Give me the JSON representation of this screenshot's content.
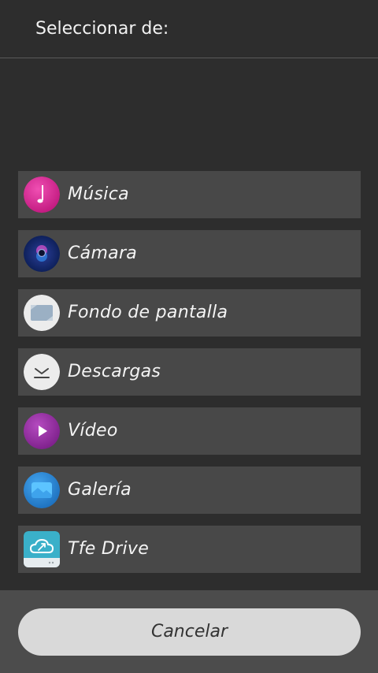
{
  "dialog": {
    "title": "Seleccionar de:"
  },
  "options": [
    {
      "label": "Música",
      "icon": "music-icon",
      "color": "#e02a9a"
    },
    {
      "label": "Cámara",
      "icon": "camera-icon",
      "color": "#0f2a6e"
    },
    {
      "label": "Fondo de pantalla",
      "icon": "wallpaper-icon",
      "color": "#e8e8e8"
    },
    {
      "label": "Descargas",
      "icon": "download-icon",
      "color": "#e8e8e8"
    },
    {
      "label": "Vídeo",
      "icon": "video-icon",
      "color": "#9a2aa0"
    },
    {
      "label": "Galería",
      "icon": "gallery-icon",
      "color": "#2b8ad6"
    },
    {
      "label": "Tfe Drive",
      "icon": "cloud-drive-icon",
      "color": "#3aa8c4"
    }
  ],
  "footer": {
    "cancel_label": "Cancelar"
  }
}
